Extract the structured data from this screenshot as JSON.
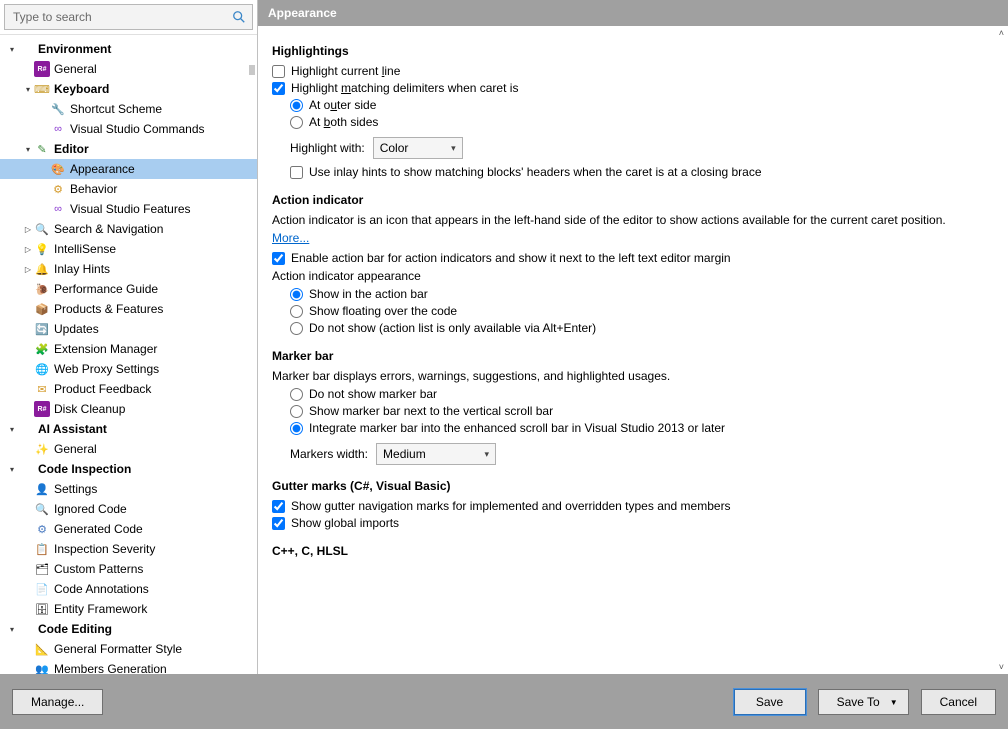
{
  "search": {
    "placeholder": "Type to search"
  },
  "tree": {
    "items": [
      {
        "level": 0,
        "arrow": "▾",
        "icon": "",
        "label": "Environment",
        "bold": true
      },
      {
        "level": 1,
        "arrow": "",
        "icon": "R#",
        "iconBg": "#8a1b9c",
        "label": "General"
      },
      {
        "level": 1,
        "arrow": "▾",
        "icon": "⌨",
        "iconColor": "#c79a2a",
        "label": "Keyboard",
        "bold": true
      },
      {
        "level": 2,
        "arrow": "",
        "icon": "🔧",
        "label": "Shortcut Scheme"
      },
      {
        "level": 2,
        "arrow": "",
        "icon": "∞",
        "iconColor": "#8a3ad0",
        "label": "Visual Studio Commands"
      },
      {
        "level": 1,
        "arrow": "▾",
        "icon": "✎",
        "iconColor": "#3a8a3a",
        "label": "Editor",
        "bold": true
      },
      {
        "level": 2,
        "arrow": "",
        "icon": "🎨",
        "label": "Appearance",
        "selected": true
      },
      {
        "level": 2,
        "arrow": "",
        "icon": "⚙",
        "iconColor": "#d49a2a",
        "label": "Behavior"
      },
      {
        "level": 2,
        "arrow": "",
        "icon": "∞",
        "iconColor": "#8a3ad0",
        "label": "Visual Studio Features"
      },
      {
        "level": 1,
        "arrow": "▷",
        "icon": "🔍",
        "label": "Search & Navigation"
      },
      {
        "level": 1,
        "arrow": "▷",
        "icon": "💡",
        "label": "IntelliSense"
      },
      {
        "level": 1,
        "arrow": "▷",
        "icon": "🔔",
        "iconColor": "#c79a2a",
        "label": "Inlay Hints"
      },
      {
        "level": 1,
        "arrow": "",
        "icon": "🐌",
        "label": "Performance Guide"
      },
      {
        "level": 1,
        "arrow": "",
        "icon": "📦",
        "label": "Products & Features"
      },
      {
        "level": 1,
        "arrow": "",
        "icon": "🔄",
        "label": "Updates"
      },
      {
        "level": 1,
        "arrow": "",
        "icon": "🧩",
        "label": "Extension Manager"
      },
      {
        "level": 1,
        "arrow": "",
        "icon": "🌐",
        "label": "Web Proxy Settings"
      },
      {
        "level": 1,
        "arrow": "",
        "icon": "✉",
        "iconColor": "#d49a2a",
        "label": "Product Feedback"
      },
      {
        "level": 1,
        "arrow": "",
        "icon": "R#",
        "iconBg": "#8a1b9c",
        "label": "Disk Cleanup"
      },
      {
        "level": 0,
        "arrow": "▾",
        "icon": "",
        "label": "AI Assistant",
        "bold": true
      },
      {
        "level": 1,
        "arrow": "",
        "icon": "✨",
        "label": "General"
      },
      {
        "level": 0,
        "arrow": "▾",
        "icon": "",
        "label": "Code Inspection",
        "bold": true
      },
      {
        "level": 1,
        "arrow": "",
        "icon": "👤",
        "label": "Settings"
      },
      {
        "level": 1,
        "arrow": "",
        "icon": "🔍",
        "label": "Ignored Code"
      },
      {
        "level": 1,
        "arrow": "",
        "icon": "⚙",
        "iconColor": "#4a7ac0",
        "label": "Generated Code"
      },
      {
        "level": 1,
        "arrow": "",
        "icon": "📋",
        "iconColor": "#c79a2a",
        "label": "Inspection Severity"
      },
      {
        "level": 1,
        "arrow": "",
        "icon": "🗂",
        "label": "Custom Patterns"
      },
      {
        "level": 1,
        "arrow": "",
        "icon": "📄",
        "label": "Code Annotations"
      },
      {
        "level": 1,
        "arrow": "",
        "icon": "🗄",
        "label": "Entity Framework"
      },
      {
        "level": 0,
        "arrow": "▾",
        "icon": "",
        "label": "Code Editing",
        "bold": true
      },
      {
        "level": 1,
        "arrow": "",
        "icon": "📐",
        "label": "General Formatter Style"
      },
      {
        "level": 1,
        "arrow": "",
        "icon": "👥",
        "label": "Members Generation"
      }
    ]
  },
  "header": {
    "title": "Appearance"
  },
  "highlightings": {
    "heading": "Highlightings",
    "highlight_current_line": "Highlight current line",
    "highlight_matching": "Highlight matching delimiters when caret is",
    "at_outer_side": "At outer side",
    "at_both_sides": "At both sides",
    "highlight_with_label": "Highlight with:",
    "highlight_with_value": "Color",
    "inlay_hints": "Use inlay hints to show matching blocks' headers when the caret is at a closing brace"
  },
  "action_indicator": {
    "heading": "Action indicator",
    "description": "Action indicator is an icon that appears in the left-hand side of the editor to show actions available for the current caret position.",
    "more": "More...",
    "enable_bar": "Enable action bar for action indicators and show it next to the left text editor margin",
    "appearance_label": "Action indicator appearance",
    "opt_show_bar": "Show in the action bar",
    "opt_float": "Show floating over the code",
    "opt_hide": "Do not show (action list is only available via Alt+Enter)"
  },
  "marker_bar": {
    "heading": "Marker bar",
    "description": "Marker bar displays errors, warnings, suggestions, and highlighted usages.",
    "opt_hide": "Do not show marker bar",
    "opt_next": "Show marker bar next to the vertical scroll bar",
    "opt_integrate": "Integrate marker bar into the enhanced scroll bar in Visual Studio 2013 or later",
    "width_label": "Markers width:",
    "width_value": "Medium"
  },
  "gutter": {
    "heading": "Gutter marks (C#, Visual Basic)",
    "show_nav": "Show gutter navigation marks for implemented and overridden types and members",
    "show_global": "Show global imports"
  },
  "cpp": {
    "heading": "C++, C, HLSL"
  },
  "footer": {
    "manage": "Manage...",
    "save": "Save",
    "save_to": "Save To",
    "cancel": "Cancel"
  }
}
